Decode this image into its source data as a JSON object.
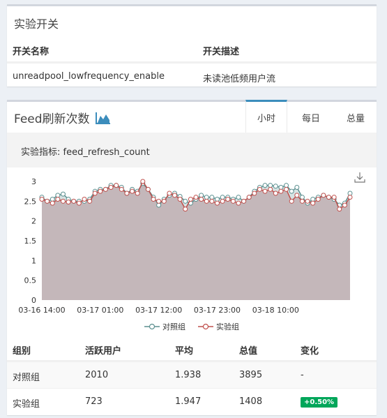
{
  "switch_card": {
    "title": "实验开关",
    "headers": [
      "开关名称",
      "开关描述"
    ],
    "rows": [
      [
        "unreadpool_lowfrequency_enable",
        "未读池低频用户流"
      ]
    ]
  },
  "feed_card": {
    "title": "Feed刷新次数",
    "title_icon": "area-chart-icon",
    "tabs": [
      {
        "label": "小时",
        "active": true
      },
      {
        "label": "每日",
        "active": false
      },
      {
        "label": "总量",
        "active": false
      }
    ],
    "metric_label": "实验指标: feed_refresh_count",
    "download_icon": "download-icon"
  },
  "chart_data": {
    "type": "area",
    "title": "",
    "xlabel": "",
    "ylabel": "",
    "ylim": [
      0,
      3
    ],
    "yticks": [
      "0",
      "0.5",
      "1",
      "1.5",
      "2",
      "2.5",
      "3"
    ],
    "xtick_labels": [
      "03-16 14:00",
      "03-17 01:00",
      "03-17 12:00",
      "03-17 23:00",
      "03-18 10:00"
    ],
    "xtick_indices": [
      0,
      11,
      22,
      33,
      44
    ],
    "legend_position": "bottom",
    "series": [
      {
        "name": "对照组",
        "color": "#5b8f8f",
        "values": [
          2.6,
          2.5,
          2.55,
          2.65,
          2.68,
          2.55,
          2.5,
          2.5,
          2.5,
          2.55,
          2.75,
          2.8,
          2.8,
          2.9,
          2.9,
          2.85,
          2.7,
          2.8,
          2.75,
          2.95,
          2.8,
          2.6,
          2.4,
          2.55,
          2.65,
          2.7,
          2.62,
          2.5,
          2.45,
          2.55,
          2.65,
          2.6,
          2.6,
          2.55,
          2.6,
          2.6,
          2.55,
          2.6,
          2.5,
          2.6,
          2.75,
          2.85,
          2.9,
          2.9,
          2.88,
          2.85,
          2.9,
          2.75,
          2.85,
          2.6,
          2.45,
          2.55,
          2.6,
          2.65,
          2.6,
          2.55,
          2.4,
          2.45,
          2.7
        ]
      },
      {
        "name": "实验组",
        "color": "#c0504d",
        "values": [
          2.55,
          2.5,
          2.45,
          2.55,
          2.5,
          2.48,
          2.5,
          2.45,
          2.55,
          2.5,
          2.7,
          2.75,
          2.8,
          2.85,
          2.9,
          2.8,
          2.7,
          2.75,
          2.7,
          3.0,
          2.8,
          2.55,
          2.5,
          2.5,
          2.7,
          2.65,
          2.55,
          2.3,
          2.55,
          2.6,
          2.55,
          2.5,
          2.5,
          2.45,
          2.5,
          2.55,
          2.5,
          2.45,
          2.5,
          2.6,
          2.7,
          2.8,
          2.75,
          2.8,
          2.7,
          2.75,
          2.8,
          2.5,
          2.65,
          2.5,
          2.5,
          2.45,
          2.55,
          2.65,
          2.6,
          2.6,
          2.3,
          2.4,
          2.6
        ]
      }
    ]
  },
  "stats_table": {
    "headers": [
      "组别",
      "活跃用户",
      "平均",
      "总值",
      "变化"
    ],
    "rows": [
      [
        "对照组",
        "2010",
        "1.938",
        "3895",
        "-"
      ],
      [
        "实验组",
        "723",
        "1.947",
        "1408",
        "+0.50%"
      ]
    ],
    "badge_color": "#00a65a"
  }
}
